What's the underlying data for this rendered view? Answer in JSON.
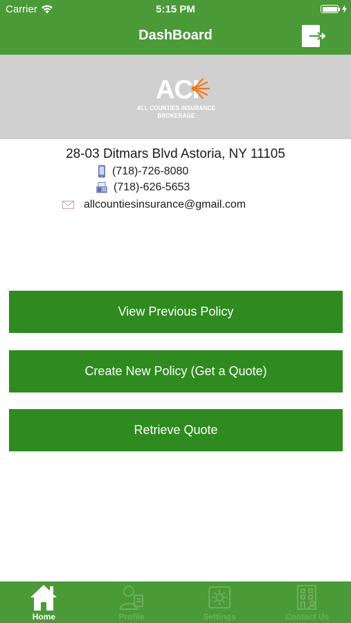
{
  "status_bar": {
    "carrier": "Carrier",
    "time": "5:15 PM"
  },
  "nav": {
    "title": "DashBoard",
    "logout_icon": "logout-icon"
  },
  "banner": {
    "logo_letters": "ACI",
    "logo_subtitle": "ALL COUNTIES INSURANCE BROKERAGE"
  },
  "contact": {
    "address": "28-03 Ditmars Blvd Astoria, NY 11105",
    "phone": "(718)-726-8080",
    "fax": "(718)-626-5653",
    "email": "allcountiesinsurance@gmail.com"
  },
  "actions": {
    "view_previous": "View Previous Policy",
    "create_new": "Create New Policy (Get a Quote)",
    "retrieve_quote": "Retrieve Quote"
  },
  "tabs": [
    {
      "label": "Home",
      "icon": "home-icon",
      "active": true
    },
    {
      "label": "Profile",
      "icon": "profile-icon",
      "active": false
    },
    {
      "label": "Settings",
      "icon": "settings-icon",
      "active": false
    },
    {
      "label": "Contact Us",
      "icon": "contact-icon",
      "active": false
    }
  ],
  "colors": {
    "primary_green": "#4a9a37",
    "button_green": "#2f8a1f",
    "banner_gray": "#d0d0d0",
    "logo_accent": "#f07a1a"
  }
}
